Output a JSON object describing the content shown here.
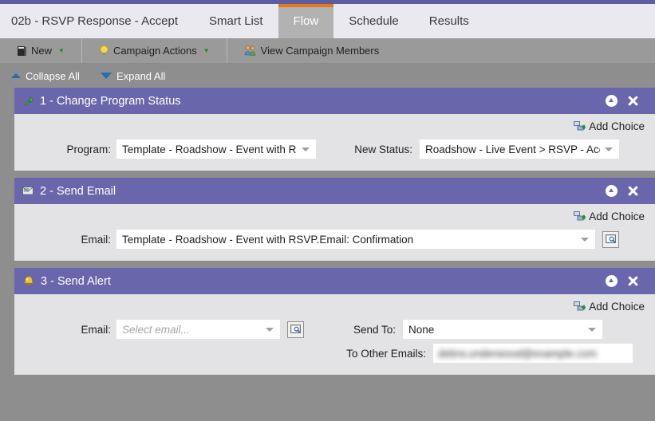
{
  "window": {
    "record_title": "02b - RSVP Response - Accept"
  },
  "tabs": [
    {
      "label": "Smart List",
      "active": false
    },
    {
      "label": "Flow",
      "active": true
    },
    {
      "label": "Schedule",
      "active": false
    },
    {
      "label": "Results",
      "active": false
    }
  ],
  "toolbar": {
    "new_label": "New",
    "campaign_actions_label": "Campaign Actions",
    "view_members_label": "View Campaign Members"
  },
  "tree_controls": {
    "collapse_all": "Collapse All",
    "expand_all": "Expand All"
  },
  "common": {
    "add_choice": "Add Choice"
  },
  "steps": [
    {
      "icon": "green-arrow-icon",
      "title": "1 - Change Program Status",
      "add_choice": "Add Choice",
      "fields": [
        {
          "label": "Program:",
          "type": "combo",
          "value": "Template - Roadshow - Event with RSVI",
          "placeholder": ""
        },
        {
          "label": "New Status:",
          "type": "combo",
          "value": "Roadshow - Live Event > RSVP - Accept",
          "placeholder": ""
        }
      ]
    },
    {
      "icon": "email-icon",
      "title": "2 - Send Email",
      "add_choice": "Add Choice",
      "fields": [
        {
          "label": "Email:",
          "type": "combo",
          "value": "Template - Roadshow - Event with RSVP.Email: Confirmation",
          "placeholder": ""
        }
      ]
    },
    {
      "icon": "alert-bell-icon",
      "title": "3 - Send Alert",
      "add_choice": "Add Choice",
      "fields": [
        {
          "label": "Email:",
          "type": "combo",
          "value": "",
          "placeholder": "Select email..."
        },
        {
          "label": "Send To:",
          "type": "combo",
          "value": "None",
          "placeholder": ""
        },
        {
          "label": "To Other Emails:",
          "type": "text",
          "value": "debra.underwood@example.com",
          "redacted": true
        }
      ]
    }
  ],
  "colors": {
    "accent_purple": "#6a66ac",
    "tab_active_orange": "#e8761d",
    "toolbar_gray": "#9a9a9a",
    "panel_body": "#e3e3e6"
  }
}
